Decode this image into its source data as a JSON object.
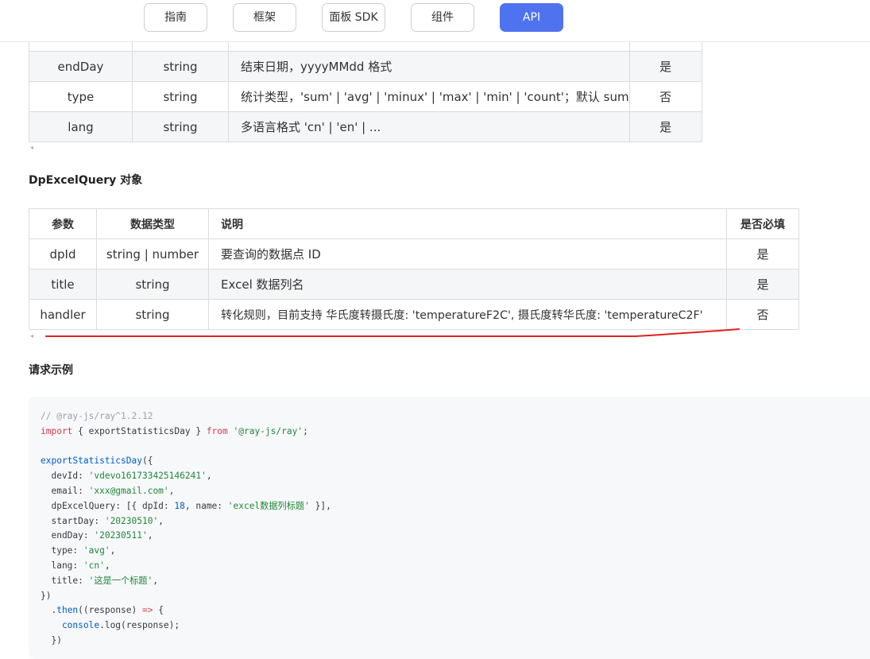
{
  "nav": {
    "items": [
      {
        "label": "指南",
        "active": false
      },
      {
        "label": "框架",
        "active": false
      },
      {
        "label": "面板 SDK",
        "active": false
      },
      {
        "label": "组件",
        "active": false
      },
      {
        "label": "API",
        "active": true
      }
    ]
  },
  "table1": {
    "rows": [
      {
        "param": "endDay",
        "type": "string",
        "desc": "结束日期，yyyyMMdd 格式",
        "required": "是"
      },
      {
        "param": "type",
        "type": "string",
        "desc": "统计类型，'sum' | 'avg' | 'minux' | 'max' | 'min' | 'count'；默认 sum",
        "required": "否"
      },
      {
        "param": "lang",
        "type": "string",
        "desc": "多语言格式 'cn' | 'en' | ...",
        "required": "是"
      }
    ]
  },
  "section_dpexcel": {
    "title": "DpExcelQuery 对象"
  },
  "table2": {
    "headers": {
      "param": "参数",
      "type": "数据类型",
      "desc": "说明",
      "required": "是否必填"
    },
    "rows": [
      {
        "param": "dpId",
        "type": "string | number",
        "desc": "要查询的数据点 ID",
        "required": "是"
      },
      {
        "param": "title",
        "type": "string",
        "desc": "Excel 数据列名",
        "required": "是"
      },
      {
        "param": "handler",
        "type": "string",
        "desc": "转化规则，目前支持 华氏度转摄氏度: 'temperatureF2C', 摄氏度转华氏度: 'temperatureC2F'",
        "required": "否"
      }
    ]
  },
  "section_example": {
    "title": "请求示例"
  },
  "annotation": {
    "color": "#e02020"
  },
  "code": {
    "lines": [
      [
        {
          "t": "// @ray-js/ray^1.2.12",
          "k": "comment"
        }
      ],
      [
        {
          "t": "import",
          "k": "keyword"
        },
        {
          "t": " { exportStatisticsDay } ",
          "k": "plain"
        },
        {
          "t": "from",
          "k": "keyword"
        },
        {
          "t": " ",
          "k": "plain"
        },
        {
          "t": "'@ray-js/ray'",
          "k": "string"
        },
        {
          "t": ";",
          "k": "plain"
        }
      ],
      [],
      [
        {
          "t": "exportStatisticsDay",
          "k": "func"
        },
        {
          "t": "({",
          "k": "plain"
        }
      ],
      [
        {
          "t": "  devId: ",
          "k": "plain"
        },
        {
          "t": "'vdevo161733425146241'",
          "k": "string"
        },
        {
          "t": ",",
          "k": "plain"
        }
      ],
      [
        {
          "t": "  email: ",
          "k": "plain"
        },
        {
          "t": "'xxx@gmail.com'",
          "k": "string"
        },
        {
          "t": ",",
          "k": "plain"
        }
      ],
      [
        {
          "t": "  dpExcelQuery: [{ dpId: ",
          "k": "plain"
        },
        {
          "t": "18",
          "k": "number"
        },
        {
          "t": ", name: ",
          "k": "plain"
        },
        {
          "t": "'excel数据列标题'",
          "k": "string"
        },
        {
          "t": " }],",
          "k": "plain"
        }
      ],
      [
        {
          "t": "  startDay: ",
          "k": "plain"
        },
        {
          "t": "'20230510'",
          "k": "string"
        },
        {
          "t": ",",
          "k": "plain"
        }
      ],
      [
        {
          "t": "  endDay: ",
          "k": "plain"
        },
        {
          "t": "'20230511'",
          "k": "string"
        },
        {
          "t": ",",
          "k": "plain"
        }
      ],
      [
        {
          "t": "  type: ",
          "k": "plain"
        },
        {
          "t": "'avg'",
          "k": "string"
        },
        {
          "t": ",",
          "k": "plain"
        }
      ],
      [
        {
          "t": "  lang: ",
          "k": "plain"
        },
        {
          "t": "'cn'",
          "k": "string"
        },
        {
          "t": ",",
          "k": "plain"
        }
      ],
      [
        {
          "t": "  title: ",
          "k": "plain"
        },
        {
          "t": "'这是一个标题'",
          "k": "string"
        },
        {
          "t": ",",
          "k": "plain"
        }
      ],
      [
        {
          "t": "})",
          "k": "plain"
        }
      ],
      [
        {
          "t": "  .",
          "k": "plain"
        },
        {
          "t": "then",
          "k": "func"
        },
        {
          "t": "((response) ",
          "k": "plain"
        },
        {
          "t": "=>",
          "k": "keyword"
        },
        {
          "t": " {",
          "k": "plain"
        }
      ],
      [
        {
          "t": "    console",
          "k": "func"
        },
        {
          "t": ".log(response);",
          "k": "plain"
        }
      ],
      [
        {
          "t": "  })",
          "k": "plain"
        }
      ]
    ]
  }
}
